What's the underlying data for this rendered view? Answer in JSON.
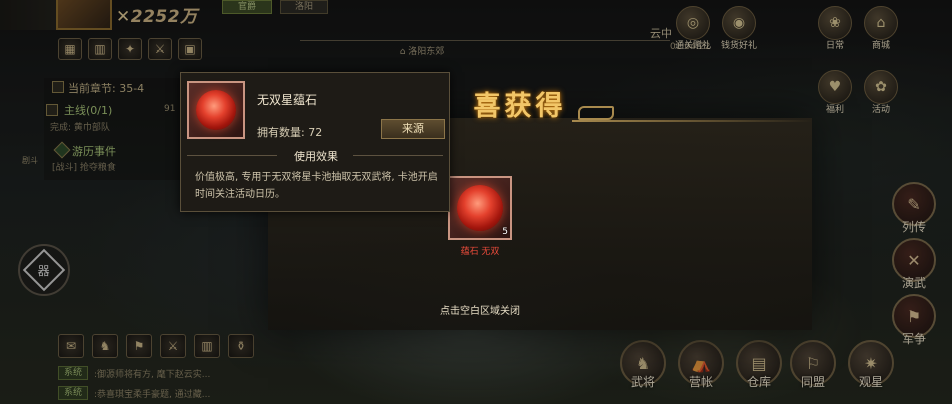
{
  "header": {
    "gold": "2252万",
    "gold_mark": "✕",
    "rank": "官爵",
    "city": "洛阳",
    "location": "洛阳东郊",
    "cloud_text": "云中",
    "clock": "01:04:22"
  },
  "left_toolbar": [
    "▦",
    "▥",
    "✦",
    "⚔",
    "▣"
  ],
  "quest": {
    "chapter": "当前章节: 35-4",
    "main": "主线(0/1)",
    "main_progress": "91",
    "main_sub": "完成: 黄巾部队",
    "event": "游历事件",
    "event_sub": "[战斗] 抢夺粮食",
    "side_tag": "剧斗"
  },
  "round_button_glyph": "器",
  "bottom_icons": [
    "✉",
    "♞",
    "⚑",
    "⚔",
    "▥",
    "⚱"
  ],
  "chat": [
    {
      "tag": "系统",
      "text": ":御源师将有方, 麾下赵云实..."
    },
    {
      "tag": "系统",
      "text": ":恭喜琪宝柔手豪题, 通过藏..."
    }
  ],
  "top_right": [
    {
      "label": "通关赠礼",
      "glyph": "◎"
    },
    {
      "label": "钱货好礼",
      "glyph": "◉"
    },
    {
      "label": "日常",
      "glyph": "❀"
    },
    {
      "label": "商城",
      "glyph": "⌂"
    },
    {
      "label": "福利",
      "glyph": "♥"
    },
    {
      "label": "活动",
      "glyph": "✿"
    }
  ],
  "right_side": [
    {
      "label": "列传",
      "glyph": "✎"
    },
    {
      "label": "演武",
      "glyph": "✕"
    },
    {
      "label": "军争",
      "glyph": "⚑"
    }
  ],
  "bottom_right": [
    {
      "label": "武将",
      "glyph": "♞"
    },
    {
      "label": "营帐",
      "glyph": "⛺"
    },
    {
      "label": "仓库",
      "glyph": "▤"
    },
    {
      "label": "同盟",
      "glyph": "⚐"
    },
    {
      "label": "观星",
      "glyph": "✷"
    }
  ],
  "reward": {
    "title": "喜获得",
    "item_name": "蕴石 无双",
    "item_count": "5",
    "close_hint": "点击空白区域关闭"
  },
  "tooltip": {
    "name": "无双星蕴石",
    "qty_label": "拥有数量: 72",
    "source_button": "来源",
    "section_title": "使用效果",
    "description": "价值极高, 专用于无双将星卡池抽取无双武将, 卡池开启时间关注活动日历。"
  },
  "colors": {
    "gold_title": "#f2c668",
    "item_red": "#e84a3a",
    "panel_border": "#5a4f3a"
  }
}
